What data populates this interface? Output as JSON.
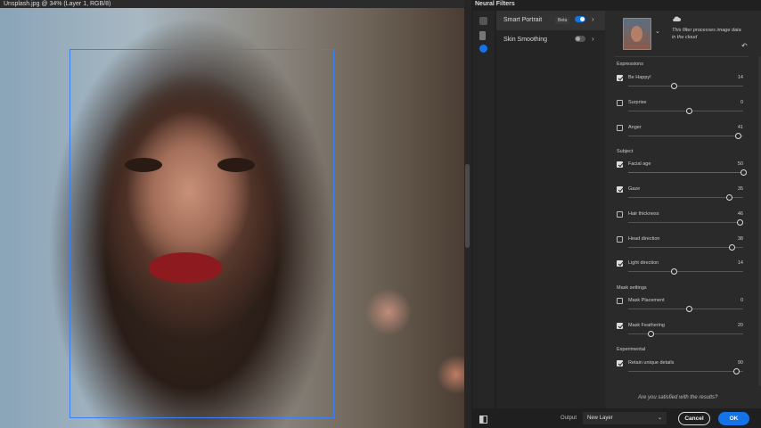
{
  "canvas": {
    "title": "Unsplash.jpg @ 34% (Layer 1, RGB/8)"
  },
  "panel": {
    "title": "Neural Filters",
    "tools": [
      "filters-list-icon",
      "brush-icon",
      "mask-icon"
    ]
  },
  "filters": [
    {
      "label": "Smart Portrait",
      "badge": "Beta",
      "enabled": true
    },
    {
      "label": "Skin Smoothing",
      "enabled": false
    }
  ],
  "cloud_note": "This filter processes image data in the cloud",
  "sections": {
    "expressions": "Expressions",
    "subject": "Subject",
    "mask_settings": "Mask settings",
    "experimental": "Experimental"
  },
  "sliders": [
    {
      "name": "Be Happy!",
      "value": "14",
      "checked": true,
      "pos": 0.4
    },
    {
      "name": "Surprise",
      "value": "0",
      "checked": false,
      "pos": 0.53
    },
    {
      "name": "Anger",
      "value": "41",
      "checked": false,
      "pos": 0.96
    },
    {
      "name": "Facial age",
      "value": "50",
      "checked": true,
      "pos": 1.0
    },
    {
      "name": "Gaze",
      "value": "35",
      "checked": true,
      "pos": 0.88
    },
    {
      "name": "Hair thickness",
      "value": "46",
      "checked": false,
      "pos": 0.97
    },
    {
      "name": "Head direction",
      "value": "38",
      "checked": false,
      "pos": 0.9
    },
    {
      "name": "Light direction",
      "value": "14",
      "checked": true,
      "pos": 0.4
    },
    {
      "name": "Mask Placement",
      "value": "0",
      "checked": false,
      "pos": 0.53
    },
    {
      "name": "Mask Feathering",
      "value": "20",
      "checked": true,
      "pos": 0.2
    },
    {
      "name": "Retain unique details",
      "value": "90",
      "checked": true,
      "pos": 0.94
    }
  ],
  "footer": {
    "satisfied": "Are you satisfied with the results?",
    "output_label": "Output",
    "output_value": "New Layer",
    "cancel": "Cancel",
    "ok": "OK"
  },
  "colors": {
    "accent": "#1473e6",
    "selection": "#3b7ff0"
  }
}
